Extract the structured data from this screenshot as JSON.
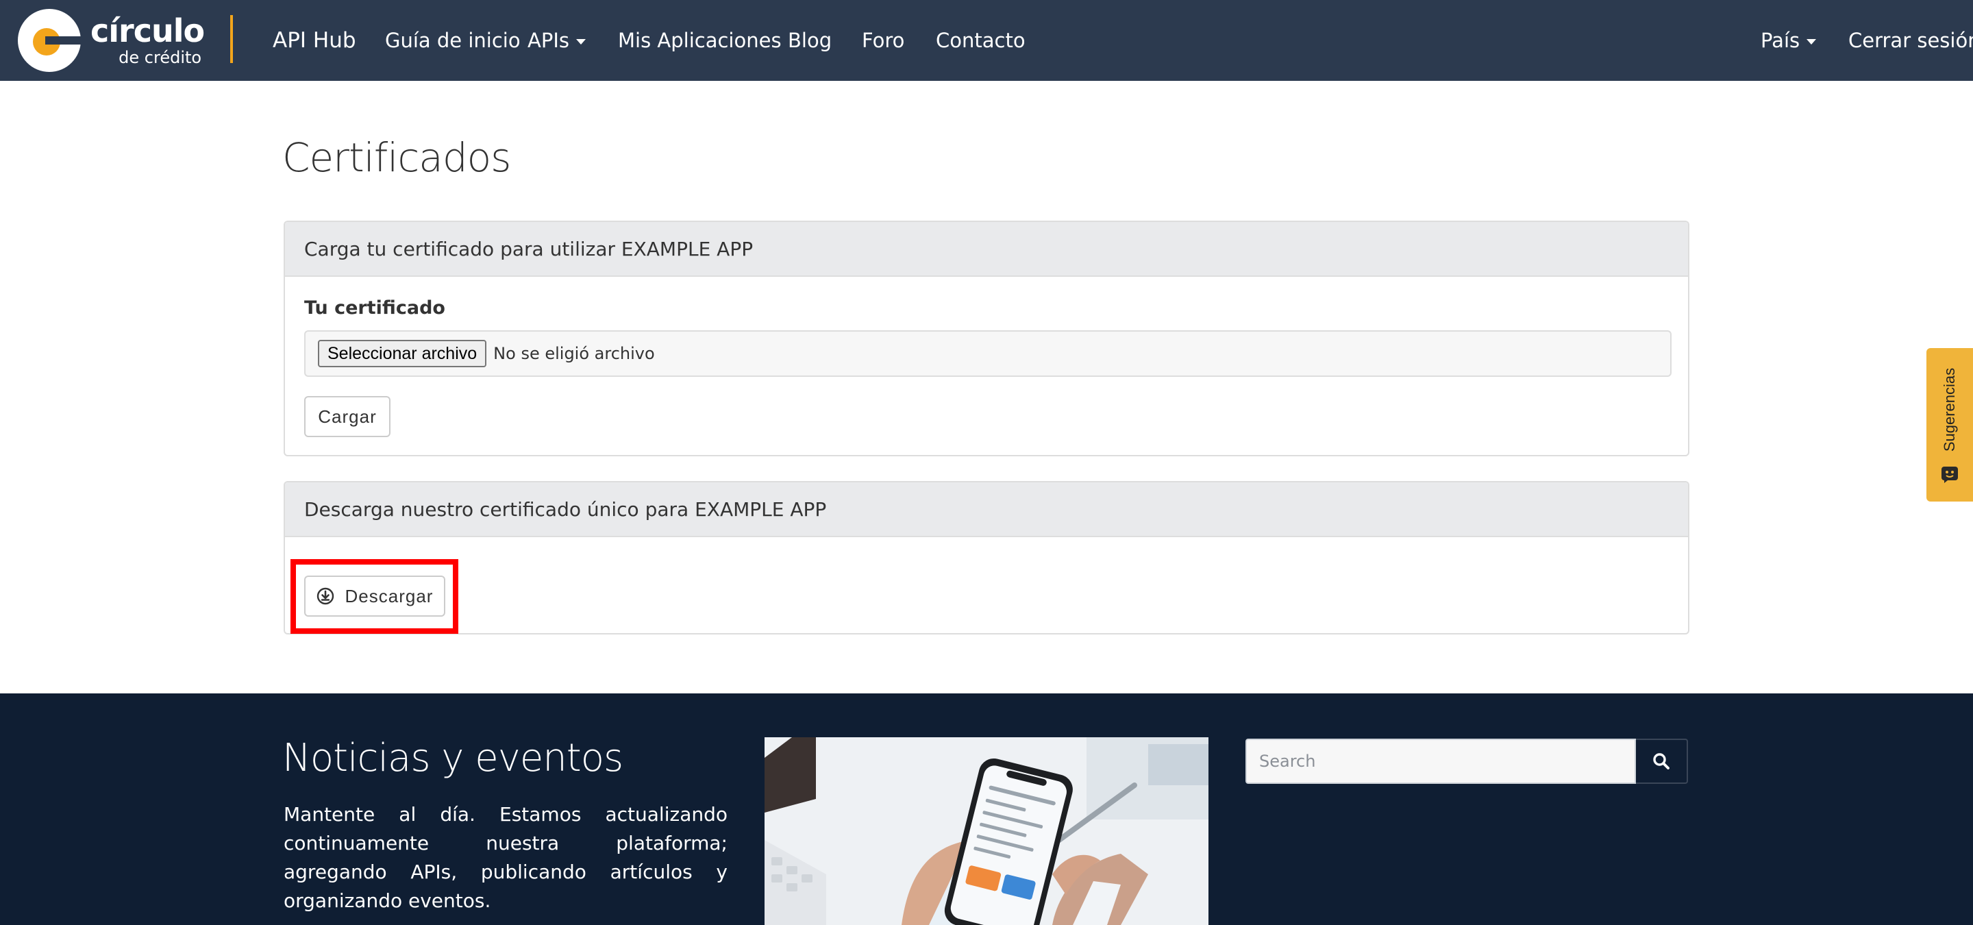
{
  "brand": {
    "name": "círculo",
    "tagline": "de crédito"
  },
  "nav": {
    "api_hub": "API Hub",
    "guide": "Guía de inicio",
    "apis": "APIs",
    "my_apps": "Mis Aplicaciones",
    "blog": "Blog",
    "forum": "Foro",
    "contact": "Contacto",
    "country": "País",
    "logout": "Cerrar sesión"
  },
  "page": {
    "title": "Certificados"
  },
  "upload_panel": {
    "heading": "Carga tu certificado para utilizar EXAMPLE APP",
    "field_label": "Tu certificado",
    "file_button": "Seleccionar archivo",
    "file_status": "No se eligió archivo",
    "submit_label": "Cargar"
  },
  "download_panel": {
    "heading": "Descarga nuestro certificado único para EXAMPLE APP",
    "download_label": "Descargar"
  },
  "suggestions": {
    "label": "Sugerencias"
  },
  "footer": {
    "title": "Noticias y eventos",
    "body": "Mantente al día. Estamos actualizando continuamente nuestra plataforma; agregando APIs, publicando artículos y organizando eventos.",
    "search_placeholder": "Search"
  },
  "colors": {
    "navbar": "#2c3a4f",
    "accent": "#f3a51b",
    "footer": "#0f1e33",
    "highlight": "#ff0000",
    "panel_heading": "#e9eaec"
  },
  "icons": [
    "circulo-logo-icon",
    "caret-down-icon",
    "download-circle-icon",
    "feedback-icon",
    "search-icon"
  ]
}
